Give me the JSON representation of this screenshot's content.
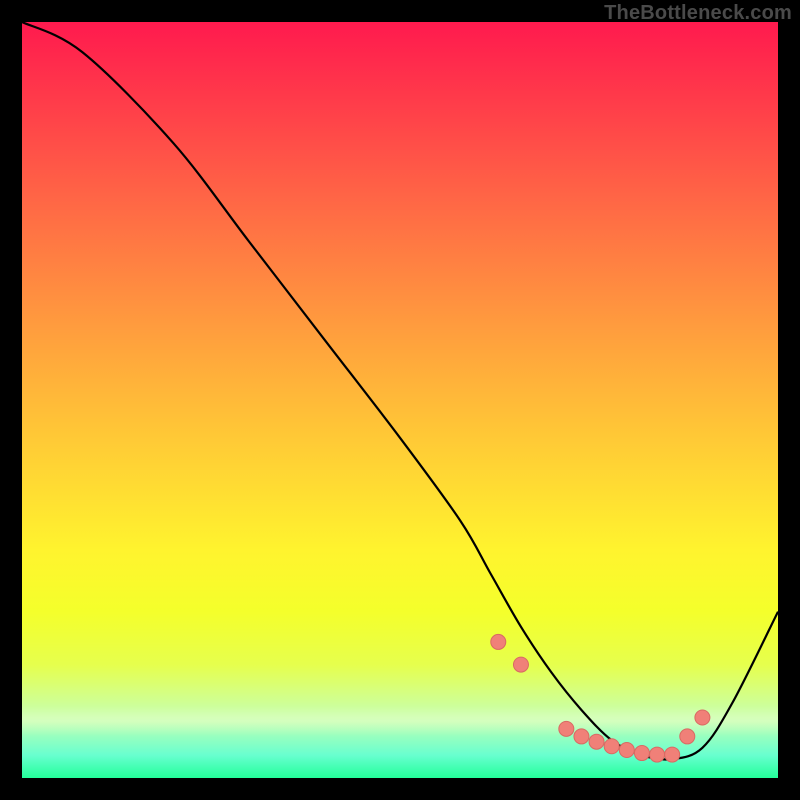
{
  "watermark": "TheBottleneck.com",
  "chart_data": {
    "type": "line",
    "title": "",
    "xlabel": "",
    "ylabel": "",
    "xlim": [
      0,
      100
    ],
    "ylim": [
      0,
      100
    ],
    "x": [
      0,
      8,
      20,
      30,
      40,
      50,
      58,
      62,
      66,
      70,
      74,
      78,
      82,
      86,
      90,
      94,
      100
    ],
    "values": [
      100,
      96,
      84,
      71,
      58,
      45,
      34,
      27,
      20,
      14,
      9,
      5,
      3,
      2.5,
      4,
      10,
      22
    ],
    "minimum_region_x": [
      63,
      66,
      72,
      74,
      76,
      78,
      80,
      82,
      84,
      86,
      88,
      90
    ],
    "minimum_region_y": [
      18,
      15,
      6.5,
      5.5,
      4.8,
      4.2,
      3.7,
      3.3,
      3.1,
      3.1,
      5.5,
      8
    ],
    "description": "Steep descending curve from top-left with a single minimum basin around x≈82–86, then rising toward the right. Background is a vertical red→yellow→green gradient. Salmon dots mark samples near the minimum."
  },
  "colors": {
    "dot_fill": "#f08078",
    "dot_stroke": "#d96a63"
  }
}
